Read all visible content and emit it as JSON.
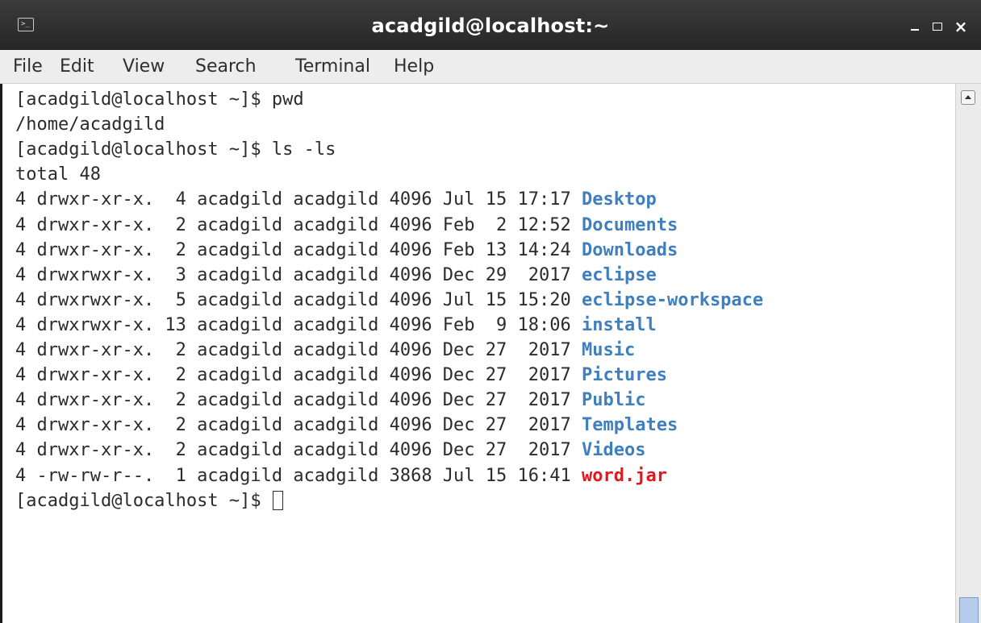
{
  "window": {
    "title": "acadgild@localhost:~",
    "app_icon_glyph": ">_",
    "close_glyph": "×"
  },
  "menu": [
    "File",
    "Edit",
    "View",
    "Search",
    "Terminal",
    "Help"
  ],
  "terminal": {
    "lines": [
      {
        "text": "[acadgild@localhost ~]$ pwd"
      },
      {
        "text": "/home/acadgild"
      },
      {
        "text": "[acadgild@localhost ~]$ ls -ls"
      },
      {
        "text": "total 48"
      },
      {
        "text": "4 drwxr-xr-x.  4 acadgild acadgild 4096 Jul 15 17:17 ",
        "name": "Desktop",
        "kind": "dir"
      },
      {
        "text": "4 drwxr-xr-x.  2 acadgild acadgild 4096 Feb  2 12:52 ",
        "name": "Documents",
        "kind": "dir"
      },
      {
        "text": "4 drwxr-xr-x.  2 acadgild acadgild 4096 Feb 13 14:24 ",
        "name": "Downloads",
        "kind": "dir"
      },
      {
        "text": "4 drwxrwxr-x.  3 acadgild acadgild 4096 Dec 29  2017 ",
        "name": "eclipse",
        "kind": "dir"
      },
      {
        "text": "4 drwxrwxr-x.  5 acadgild acadgild 4096 Jul 15 15:20 ",
        "name": "eclipse-workspace",
        "kind": "dir"
      },
      {
        "text": "4 drwxrwxr-x. 13 acadgild acadgild 4096 Feb  9 18:06 ",
        "name": "install",
        "kind": "dir"
      },
      {
        "text": "4 drwxr-xr-x.  2 acadgild acadgild 4096 Dec 27  2017 ",
        "name": "Music",
        "kind": "dir"
      },
      {
        "text": "4 drwxr-xr-x.  2 acadgild acadgild 4096 Dec 27  2017 ",
        "name": "Pictures",
        "kind": "dir"
      },
      {
        "text": "4 drwxr-xr-x.  2 acadgild acadgild 4096 Dec 27  2017 ",
        "name": "Public",
        "kind": "dir"
      },
      {
        "text": "4 drwxr-xr-x.  2 acadgild acadgild 4096 Dec 27  2017 ",
        "name": "Templates",
        "kind": "dir"
      },
      {
        "text": "4 drwxr-xr-x.  2 acadgild acadgild 4096 Dec 27  2017 ",
        "name": "Videos",
        "kind": "dir"
      },
      {
        "text": "4 -rw-rw-r--.  1 acadgild acadgild 3868 Jul 15 16:41 ",
        "name": "word.jar",
        "kind": "jar"
      },
      {
        "text": "[acadgild@localhost ~]$ ",
        "cursor": true
      }
    ]
  },
  "colors": {
    "directory": "#3f7fbd",
    "archive": "#e8151c",
    "text": "#2b2b2b",
    "titlebar": "#2e2e2e",
    "menubar": "#ededed"
  },
  "icons": [
    "terminal-icon",
    "minimize-icon",
    "maximize-icon",
    "close-icon",
    "scroll-up-arrow-icon"
  ]
}
